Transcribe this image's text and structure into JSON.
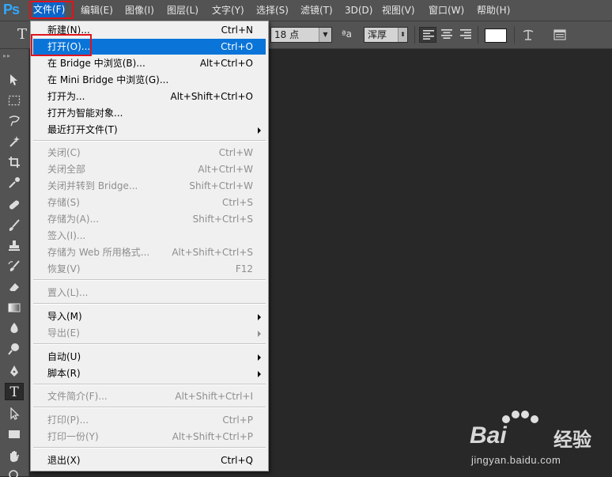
{
  "app": {
    "logo": "Ps"
  },
  "menubar": {
    "items": [
      {
        "label": "文件(F)",
        "active": true
      },
      {
        "label": "编辑(E)"
      },
      {
        "label": "图像(I)"
      },
      {
        "label": "图层(L)"
      },
      {
        "label": "文字(Y)"
      },
      {
        "label": "选择(S)"
      },
      {
        "label": "滤镜(T)"
      },
      {
        "label": "3D(D)"
      },
      {
        "label": "视图(V)"
      },
      {
        "label": "窗口(W)"
      },
      {
        "label": "帮助(H)"
      }
    ]
  },
  "options": {
    "tool_glyph": "T",
    "font_size": "18 点",
    "antialias_icon_label": "ªa",
    "antialias": "浑厚",
    "text_color": "#ffffff"
  },
  "file_menu": {
    "items": [
      {
        "label": "新建(N)...",
        "shortcut": "Ctrl+N",
        "disabled": false
      },
      {
        "label": "打开(O)...",
        "shortcut": "Ctrl+O",
        "disabled": false,
        "highlighted": true
      },
      {
        "label": "在 Bridge 中浏览(B)...",
        "shortcut": "Alt+Ctrl+O",
        "disabled": false
      },
      {
        "label": "在 Mini Bridge 中浏览(G)...",
        "shortcut": "",
        "disabled": false
      },
      {
        "label": "打开为...",
        "shortcut": "Alt+Shift+Ctrl+O",
        "disabled": false
      },
      {
        "label": "打开为智能对象...",
        "shortcut": "",
        "disabled": false
      },
      {
        "label": "最近打开文件(T)",
        "shortcut": "",
        "disabled": false,
        "submenu": true
      },
      {
        "label": "关闭(C)",
        "shortcut": "Ctrl+W",
        "disabled": true
      },
      {
        "label": "关闭全部",
        "shortcut": "Alt+Ctrl+W",
        "disabled": true
      },
      {
        "label": "关闭并转到 Bridge...",
        "shortcut": "Shift+Ctrl+W",
        "disabled": true
      },
      {
        "label": "存储(S)",
        "shortcut": "Ctrl+S",
        "disabled": true
      },
      {
        "label": "存储为(A)...",
        "shortcut": "Shift+Ctrl+S",
        "disabled": true
      },
      {
        "label": "签入(I)...",
        "shortcut": "",
        "disabled": true
      },
      {
        "label": "存储为 Web 所用格式...",
        "shortcut": "Alt+Shift+Ctrl+S",
        "disabled": true
      },
      {
        "label": "恢复(V)",
        "shortcut": "F12",
        "disabled": true
      },
      {
        "label": "置入(L)...",
        "shortcut": "",
        "disabled": true
      },
      {
        "label": "导入(M)",
        "shortcut": "",
        "disabled": false,
        "submenu": true
      },
      {
        "label": "导出(E)",
        "shortcut": "",
        "disabled": true,
        "submenu": true
      },
      {
        "label": "自动(U)",
        "shortcut": "",
        "disabled": false,
        "submenu": true
      },
      {
        "label": "脚本(R)",
        "shortcut": "",
        "disabled": false,
        "submenu": true
      },
      {
        "label": "文件简介(F)...",
        "shortcut": "Alt+Shift+Ctrl+I",
        "disabled": true
      },
      {
        "label": "打印(P)...",
        "shortcut": "Ctrl+P",
        "disabled": true
      },
      {
        "label": "打印一份(Y)",
        "shortcut": "Alt+Shift+Ctrl+P",
        "disabled": true
      },
      {
        "label": "退出(X)",
        "shortcut": "Ctrl+Q",
        "disabled": false
      }
    ]
  },
  "watermark": {
    "brand": "Bai",
    "brand_suffix": "经验",
    "url": "jingyan.baidu.com"
  }
}
